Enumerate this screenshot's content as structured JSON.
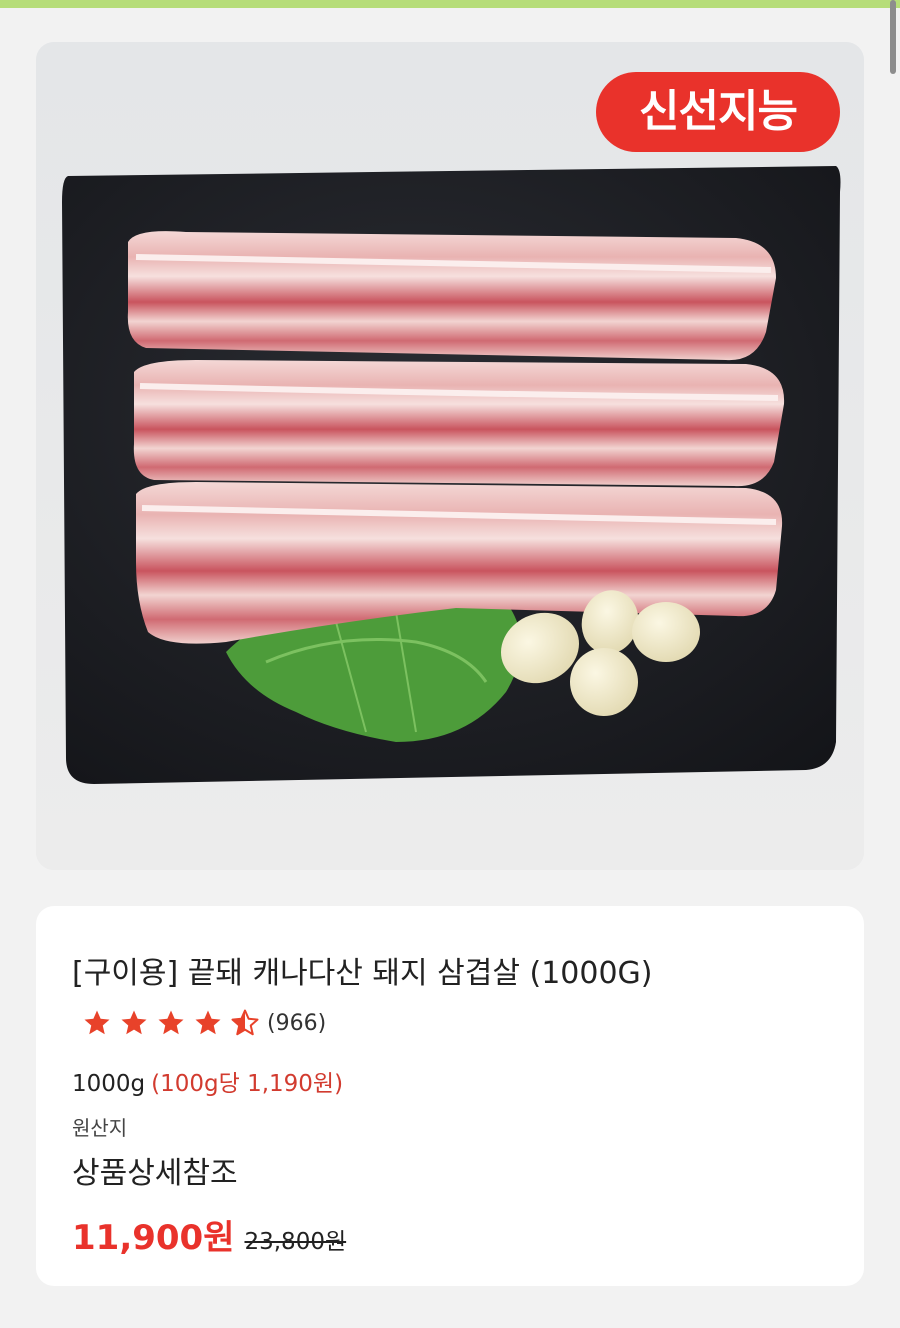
{
  "badge": {
    "label": "신선지능"
  },
  "product": {
    "title": "[구이용] 끝돼 캐나다산 돼지 삼겹살 (1000G)",
    "rating": 4.5,
    "rating_max": 5,
    "review_count": "(966)",
    "weight": "1000g",
    "unit_price": "(100g당 1,190원)",
    "origin_label": "원산지",
    "origin_value": "상품상세참조",
    "sale_price": "11,900원",
    "original_price": "23,800원"
  },
  "colors": {
    "accent_red": "#e9322b",
    "unit_price_red": "#d23b2f",
    "top_accent_green": "#b6dd79",
    "star_orange": "#e8422a"
  },
  "image": {
    "description_icon": "pork-belly-photo"
  }
}
